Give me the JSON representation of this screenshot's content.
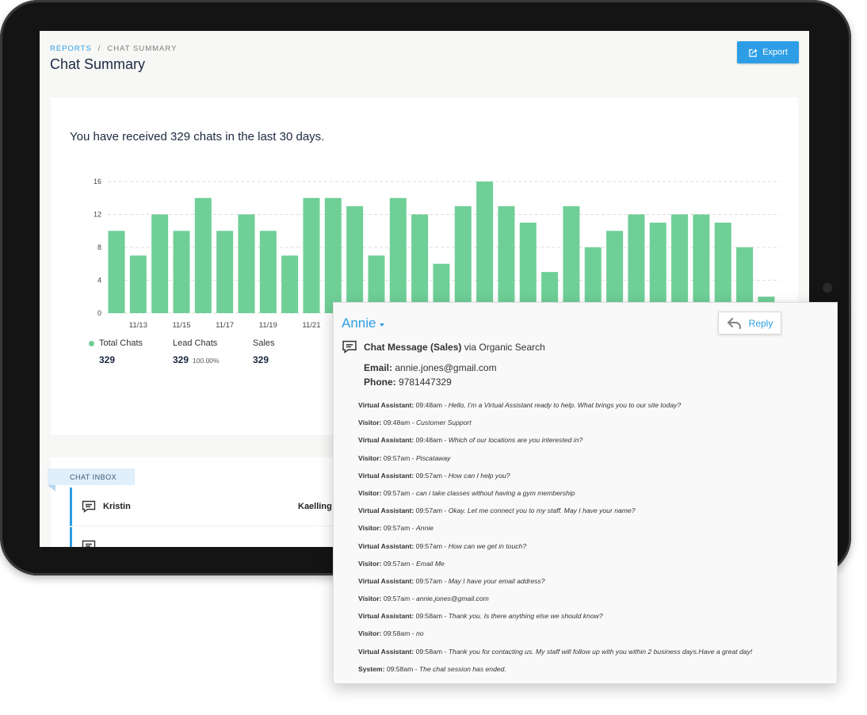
{
  "breadcrumb": {
    "root": "REPORTS",
    "separator": "/",
    "current": "CHAT SUMMARY"
  },
  "page_title": "Chat Summary",
  "export_label": "Export",
  "headline": "You have received 329 chats in the last 30 days.",
  "stats": [
    {
      "label": "Total Chats",
      "value": "329",
      "pct": "",
      "has_dot": true
    },
    {
      "label": "Lead Chats",
      "value": "329",
      "pct": "100.00%",
      "has_dot": false
    },
    {
      "label": "Sales",
      "value": "329",
      "pct": "",
      "has_dot": false
    }
  ],
  "inbox": {
    "tab_label": "CHAT INBOX",
    "rows": [
      {
        "first": "Kristin",
        "last": "Kaelling"
      },
      {
        "first": "",
        "last": ""
      }
    ]
  },
  "chat_panel": {
    "name": "Annie",
    "reply_label": "Reply",
    "message_type": "Chat Message (Sales)",
    "message_source": "via Organic Search",
    "email_label": "Email:",
    "email": "annie.jones@gmail.com",
    "phone_label": "Phone:",
    "phone": "9781447329",
    "transcript": [
      {
        "speaker": "Virtual Assistant:",
        "time": "09:48am -",
        "text": "Hello, I'm a Virtual Assistant ready to help. What brings you to our site today?"
      },
      {
        "speaker": "Visitor:",
        "time": "09:48am -",
        "text": "Customer Support"
      },
      {
        "speaker": "Virtual Assistant:",
        "time": "09:48am -",
        "text": "Which of our locations are you interested in?"
      },
      {
        "speaker": "Visitor:",
        "time": "09:57am -",
        "text": "Piscataway"
      },
      {
        "speaker": "Virtual Assistant:",
        "time": "09:57am -",
        "text": "How can I help you?"
      },
      {
        "speaker": "Visitor:",
        "time": "09:57am -",
        "text": "can i take classes without having a gym membership"
      },
      {
        "speaker": "Virtual Assistant:",
        "time": "09:57am -",
        "text": "Okay. Let me connect you to my staff. May I have your name?"
      },
      {
        "speaker": "Visitor:",
        "time": "09:57am -",
        "text": "Annie"
      },
      {
        "speaker": "Virtual Assistant:",
        "time": "09:57am -",
        "text": "How can we get in touch?"
      },
      {
        "speaker": "Visitor:",
        "time": "09:57am -",
        "text": "Email Me"
      },
      {
        "speaker": "Virtual Assistant:",
        "time": "09:57am -",
        "text": "May I have your email address?"
      },
      {
        "speaker": "Visitor:",
        "time": "09:57am -",
        "text": "annie.jones@gmail.com"
      },
      {
        "speaker": "Virtual Assistant:",
        "time": "09:58am -",
        "text": "Thank you. Is there anything else we should know?"
      },
      {
        "speaker": "Visitor:",
        "time": "09:58am -",
        "text": "no"
      },
      {
        "speaker": "Virtual Assistant:",
        "time": "09:58am -",
        "text": "Thank you for contacting us. My staff will follow up with you within 2 business days.Have a great day!"
      },
      {
        "speaker": "System:",
        "time": "09:58am -",
        "text": "The chat session has ended."
      }
    ]
  },
  "chart_data": {
    "type": "bar",
    "title": "",
    "xlabel": "",
    "ylabel": "",
    "ylim": [
      0,
      16
    ],
    "yticks": [
      0,
      4,
      8,
      12,
      16
    ],
    "grid": true,
    "bar_color": "#6fcf97",
    "x_tick_labels": [
      "11/13",
      "11/15",
      "11/17",
      "11/19",
      "11/21"
    ],
    "values": [
      10,
      7,
      12,
      10,
      14,
      10,
      12,
      10,
      7,
      14,
      14,
      13,
      7,
      14,
      12,
      6,
      13,
      16,
      13,
      11,
      5,
      13,
      8,
      10,
      12,
      11,
      12,
      12,
      11,
      8,
      2
    ]
  }
}
